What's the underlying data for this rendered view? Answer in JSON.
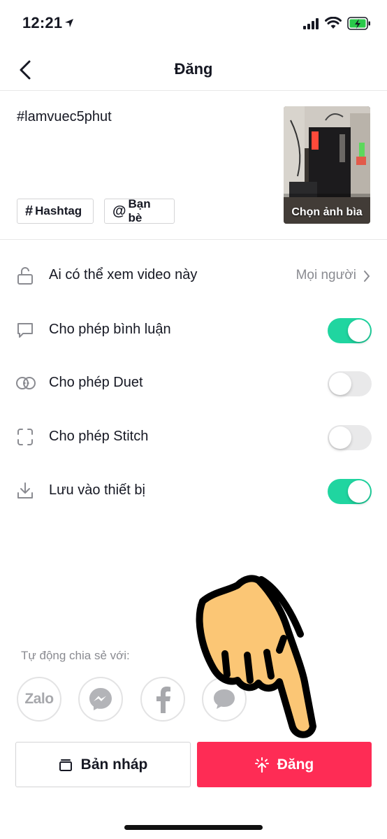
{
  "status": {
    "time": "12:21"
  },
  "nav": {
    "title": "Đăng"
  },
  "post": {
    "caption": "#lamvuec5phut",
    "hashtag_chip": "Hashtag",
    "mention_chip": "Bạn bè",
    "cover_label": "Chọn ảnh bìa"
  },
  "settings": {
    "privacy": {
      "label": "Ai có thể xem video này",
      "value": "Mọi người"
    },
    "comments": {
      "label": "Cho phép bình luận",
      "enabled": true
    },
    "duet": {
      "label": "Cho phép Duet",
      "enabled": false
    },
    "stitch": {
      "label": "Cho phép Stitch",
      "enabled": false
    },
    "save": {
      "label": "Lưu vào thiết bị",
      "enabled": true
    }
  },
  "share": {
    "label": "Tự động chia sẻ với:",
    "targets": [
      {
        "name": "zalo",
        "text": "Zalo",
        "icon": "zalo-icon"
      },
      {
        "name": "messenger",
        "icon": "messenger-icon"
      },
      {
        "name": "facebook",
        "icon": "facebook-icon"
      },
      {
        "name": "message",
        "icon": "message-icon"
      }
    ]
  },
  "actions": {
    "draft": "Bản nháp",
    "post": "Đăng"
  },
  "colors": {
    "accent": "#fe2c55",
    "toggle_on": "#20d5a0",
    "muted": "#8a8b91"
  }
}
